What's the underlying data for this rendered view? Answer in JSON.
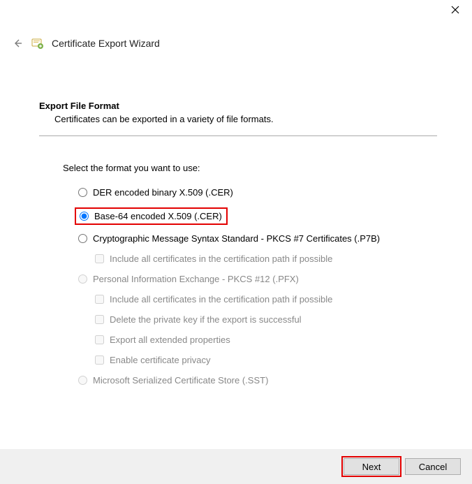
{
  "wizard": {
    "title": "Certificate Export Wizard"
  },
  "page": {
    "heading": "Export File Format",
    "subheading": "Certificates can be exported in a variety of file formats.",
    "instruction": "Select the format you want to use:"
  },
  "options": {
    "der": {
      "label": "DER encoded binary X.509 (.CER)"
    },
    "base64": {
      "label": "Base-64 encoded X.509 (.CER)"
    },
    "pkcs7": {
      "label": "Cryptographic Message Syntax Standard - PKCS #7 Certificates (.P7B)"
    },
    "pkcs7_include": {
      "label": "Include all certificates in the certification path if possible"
    },
    "pfx": {
      "label": "Personal Information Exchange - PKCS #12 (.PFX)"
    },
    "pfx_include": {
      "label": "Include all certificates in the certification path if possible"
    },
    "pfx_deletekey": {
      "label": "Delete the private key if the export is successful"
    },
    "pfx_exportext": {
      "label": "Export all extended properties"
    },
    "pfx_certprivacy": {
      "label": "Enable certificate privacy"
    },
    "sst": {
      "label": "Microsoft Serialized Certificate Store (.SST)"
    }
  },
  "buttons": {
    "next": "Next",
    "cancel": "Cancel"
  }
}
